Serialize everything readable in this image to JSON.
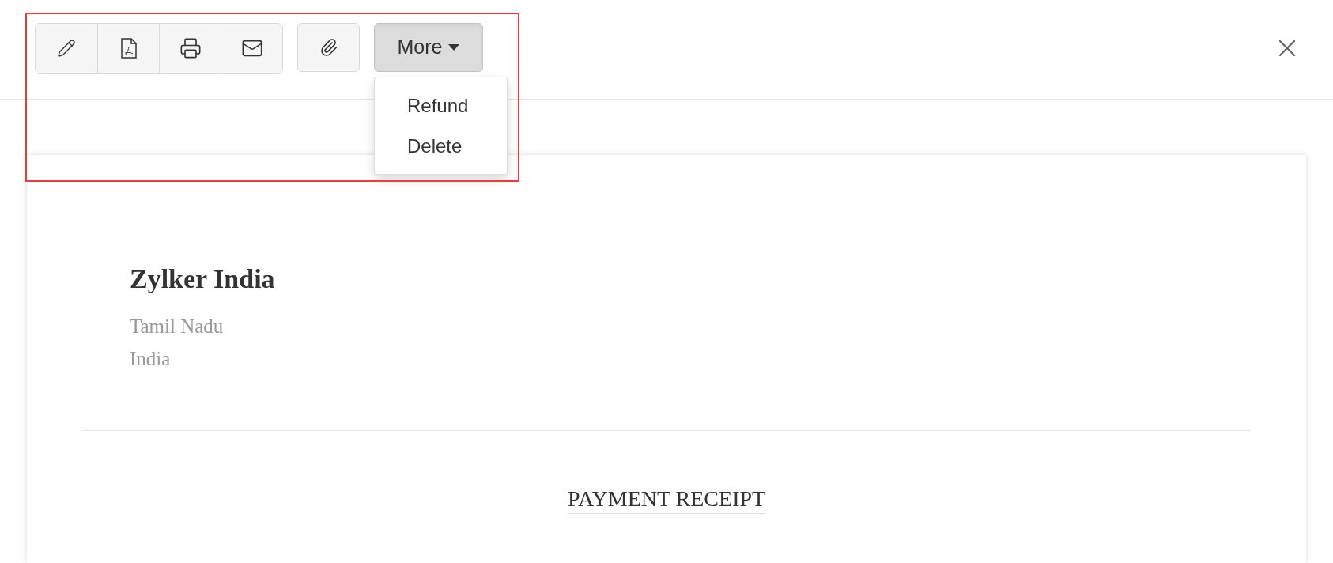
{
  "toolbar": {
    "more_button": {
      "label": "More",
      "expanded": true
    },
    "more_menu": [
      "Refund",
      "Delete"
    ]
  },
  "receipt": {
    "company": "Zylker India",
    "address_lines": [
      "Tamil Nadu",
      "India"
    ],
    "title": "PAYMENT RECEIPT"
  }
}
